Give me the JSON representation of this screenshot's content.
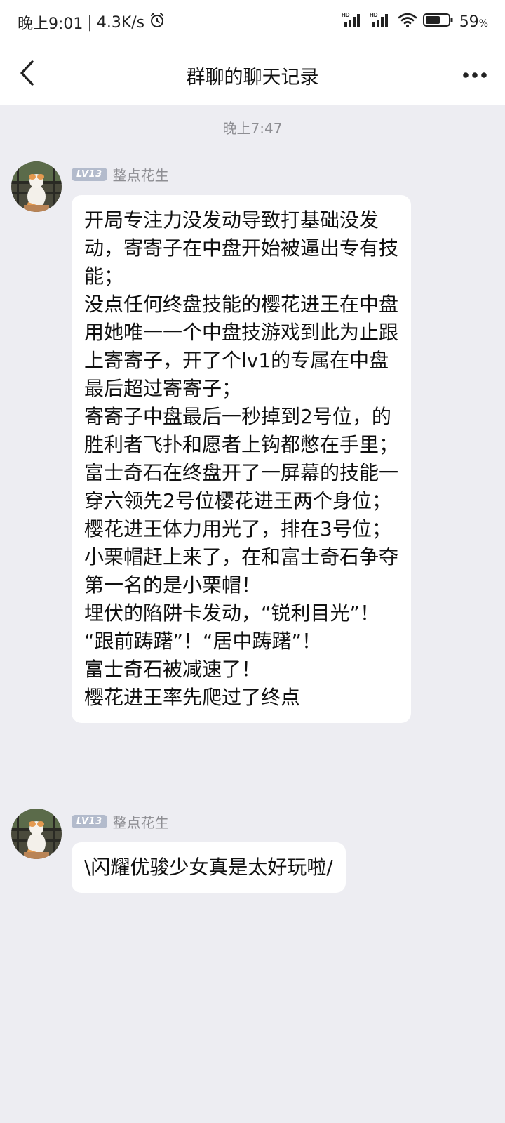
{
  "status_bar": {
    "time": "晚上9:01",
    "separator": "|",
    "network_speed": "4.3K/s",
    "battery_percent": "59",
    "battery_unit": "%",
    "icons": [
      "alarm-icon",
      "hd-signal-icon",
      "hd-signal-icon",
      "wifi-icon",
      "battery-icon"
    ]
  },
  "header": {
    "title": "群聊的聊天记录",
    "back_icon": "chevron-left-icon",
    "more_icon": "more-horizontal-icon"
  },
  "conversation": {
    "timestamp": "晚上7:47",
    "messages": [
      {
        "level": "LV13",
        "sender": "整点花生",
        "text": "开局专注力没发动导致打基础没发动，寄寄子在中盘开始被逼出专有技能；\n没点任何终盘技能的樱花进王在中盘用她唯一一个中盘技游戏到此为止跟上寄寄子，开了个lv1的专属在中盘最后超过寄寄子；\n寄寄子中盘最后一秒掉到2号位，的胜利者飞扑和愿者上钩都憋在手里；\n富士奇石在终盘开了一屏幕的技能一穿六领先2号位樱花进王两个身位；\n樱花进王体力用光了，排在3号位；\n小栗帽赶上来了，在和富士奇石争夺第一名的是小栗帽！\n埋伏的陷阱卡发动，“锐利目光”！\n“跟前踌躇”！“居中踌躇”！\n富士奇石被减速了！\n樱花进王率先爬过了终点"
      },
      {
        "level": "LV13",
        "sender": "整点花生",
        "text": "\\闪耀优骏少女真是太好玩啦/"
      }
    ]
  },
  "colors": {
    "background": "#ededf2",
    "bubble": "#ffffff",
    "meta_text": "#8e8e93",
    "level_badge": "#b3bbcc"
  }
}
